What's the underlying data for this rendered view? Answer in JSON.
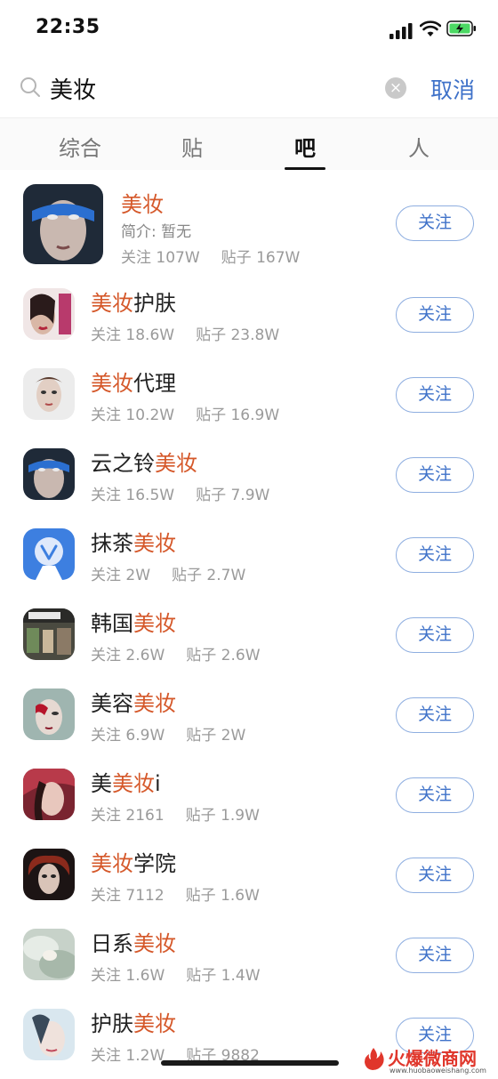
{
  "status_bar": {
    "time": "22:35"
  },
  "search": {
    "query": "美妆",
    "cancel_label": "取消"
  },
  "tabs": [
    {
      "label": "综合",
      "active": false
    },
    {
      "label": "贴",
      "active": false
    },
    {
      "label": "吧",
      "active": true
    },
    {
      "label": "人",
      "active": false
    }
  ],
  "results": [
    {
      "name_pre": "",
      "name_hl": "美妆",
      "name_post": "",
      "intro": "简介: 暂无",
      "follows": "关注 107W",
      "posts": "贴子 167W",
      "follow_label": "关注"
    },
    {
      "name_pre": "",
      "name_hl": "美妆",
      "name_post": "护肤",
      "follows": "关注 18.6W",
      "posts": "贴子 23.8W",
      "follow_label": "关注"
    },
    {
      "name_pre": "",
      "name_hl": "美妆",
      "name_post": "代理",
      "follows": "关注 10.2W",
      "posts": "贴子 16.9W",
      "follow_label": "关注"
    },
    {
      "name_pre": "云之铃",
      "name_hl": "美妆",
      "name_post": "",
      "follows": "关注 16.5W",
      "posts": "贴子 7.9W",
      "follow_label": "关注"
    },
    {
      "name_pre": "抹茶",
      "name_hl": "美妆",
      "name_post": "",
      "follows": "关注 2W",
      "posts": "贴子 2.7W",
      "follow_label": "关注"
    },
    {
      "name_pre": "韩国",
      "name_hl": "美妆",
      "name_post": "",
      "follows": "关注 2.6W",
      "posts": "贴子 2.6W",
      "follow_label": "关注"
    },
    {
      "name_pre": "美容",
      "name_hl": "美妆",
      "name_post": "",
      "follows": "关注 6.9W",
      "posts": "贴子 2W",
      "follow_label": "关注"
    },
    {
      "name_pre": "美",
      "name_hl": "美妆",
      "name_post": "i",
      "follows": "关注 2161",
      "posts": "贴子 1.9W",
      "follow_label": "关注"
    },
    {
      "name_pre": "",
      "name_hl": "美妆",
      "name_post": "学院",
      "follows": "关注 7112",
      "posts": "贴子 1.6W",
      "follow_label": "关注"
    },
    {
      "name_pre": "日系",
      "name_hl": "美妆",
      "name_post": "",
      "follows": "关注 1.6W",
      "posts": "贴子 1.4W",
      "follow_label": "关注"
    },
    {
      "name_pre": "护肤",
      "name_hl": "美妆",
      "name_post": "",
      "follows": "关注 1.2W",
      "posts": "贴子 9882",
      "follow_label": "关注"
    }
  ],
  "watermark": {
    "text": "火爆微商网",
    "url": "www.huobaoweishang.com"
  },
  "colors": {
    "highlight": "#d5582a",
    "accent": "#3f72c9"
  }
}
